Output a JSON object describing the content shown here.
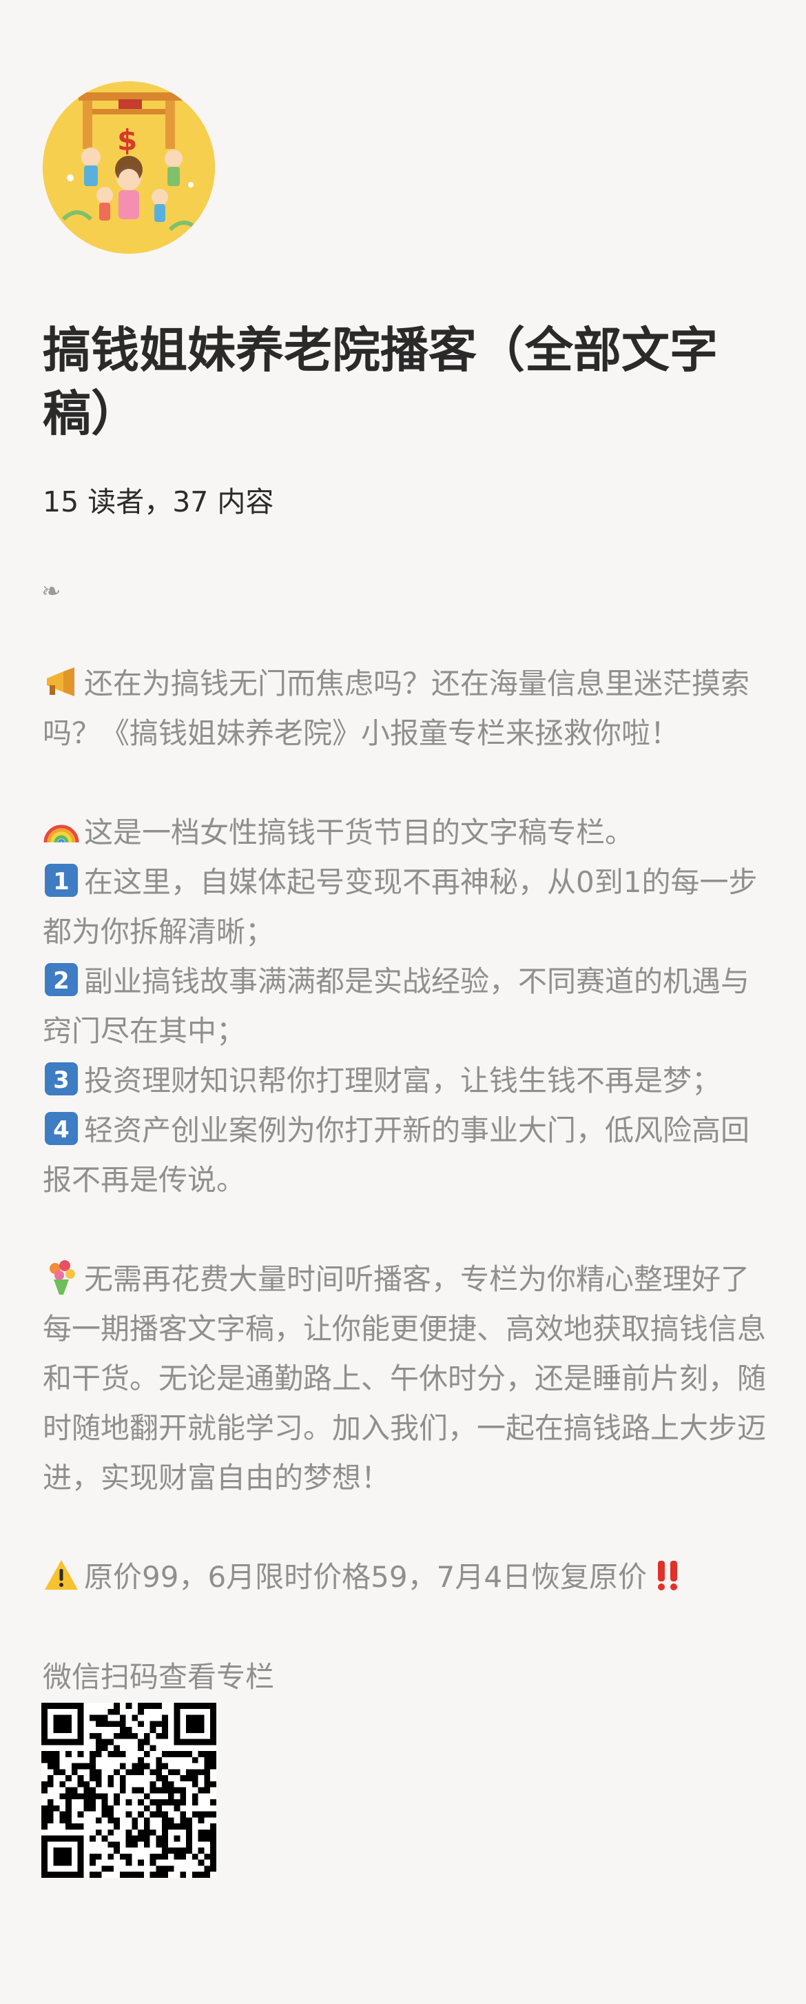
{
  "column": {
    "title": "搞钱姐妹养老院播客（全部文字稿）",
    "meta": "15 读者，37 内容",
    "divider_icon": "❧"
  },
  "description": {
    "intro": "还在为搞钱无门而焦虑吗？还在海量信息里迷茫摸索吗？《搞钱姐妹养老院》小报童专栏来拯救你啦！",
    "intro_icon": "megaphone-icon",
    "about": "这是一档女性搞钱干货节目的文字稿专栏。",
    "about_icon": "rainbow-icon",
    "points": [
      {
        "icon": "keycap-1-icon",
        "text": "在这里，自媒体起号变现不再神秘，从0到1的每一步都为你拆解清晰；"
      },
      {
        "icon": "keycap-2-icon",
        "text": "副业搞钱故事满满都是实战经验，不同赛道的机遇与窍门尽在其中；"
      },
      {
        "icon": "keycap-3-icon",
        "text": "投资理财知识帮你打理财富，让钱生钱不再是梦；"
      },
      {
        "icon": "keycap-4-icon",
        "text": "轻资产创业案例为你打开新的事业大门，低风险高回报不再是传说。"
      }
    ],
    "body_icon": "bouquet-icon",
    "body": "无需再花费大量时间听播客，专栏为你精心整理好了每一期播客文字稿，让你能更便捷、高效地获取搞钱信息和干货。无论是通勤路上、午休时分，还是睡前片刻，随时随地翻开就能学习。加入我们，一起在搞钱路上大步迈进，实现财富自由的梦想！",
    "price_icon": "warning-icon",
    "price": "原价99，6月限时价格59，7月4日恢复原价",
    "price_end_icon": "double-exclamation-icon"
  },
  "qr": {
    "label": "微信扫码查看专栏"
  },
  "colors": {
    "background": "#f7f6f4",
    "title": "#2a2a2a",
    "muted_text": "#8f8f8f",
    "keycap_blue": "#3e7cc3"
  }
}
